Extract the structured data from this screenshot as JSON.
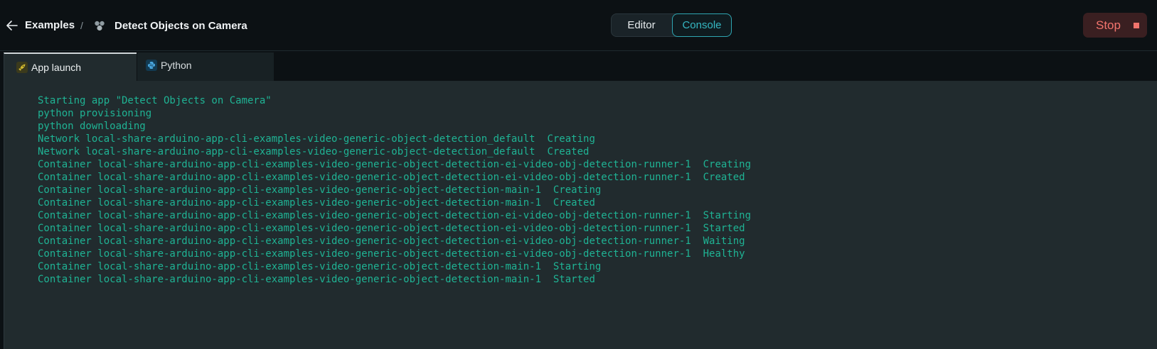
{
  "header": {
    "breadcrumb_root": "Examples",
    "breadcrumb_sep": "/",
    "app_title": "Detect Objects on Camera",
    "view_toggle": {
      "editor_label": "Editor",
      "console_label": "Console",
      "active": "Console"
    },
    "stop_label": "Stop"
  },
  "tabs": [
    {
      "label": "App launch",
      "icon": "rocket-icon",
      "active": true,
      "icon_color": "#c9b22f"
    },
    {
      "label": "Python",
      "icon": "python-icon",
      "active": false,
      "icon_color": "#2b8ec9"
    }
  ],
  "console": {
    "text_color": "#1fb394",
    "lines": [
      "Starting app \"Detect Objects on Camera\"",
      "python provisioning",
      "python downloading",
      "Network local-share-arduino-app-cli-examples-video-generic-object-detection_default  Creating",
      "Network local-share-arduino-app-cli-examples-video-generic-object-detection_default  Created",
      "Container local-share-arduino-app-cli-examples-video-generic-object-detection-ei-video-obj-detection-runner-1  Creating",
      "Container local-share-arduino-app-cli-examples-video-generic-object-detection-ei-video-obj-detection-runner-1  Created",
      "Container local-share-arduino-app-cli-examples-video-generic-object-detection-main-1  Creating",
      "Container local-share-arduino-app-cli-examples-video-generic-object-detection-main-1  Created",
      "Container local-share-arduino-app-cli-examples-video-generic-object-detection-ei-video-obj-detection-runner-1  Starting",
      "Container local-share-arduino-app-cli-examples-video-generic-object-detection-ei-video-obj-detection-runner-1  Started",
      "Container local-share-arduino-app-cli-examples-video-generic-object-detection-ei-video-obj-detection-runner-1  Waiting",
      "Container local-share-arduino-app-cli-examples-video-generic-object-detection-ei-video-obj-detection-runner-1  Healthy",
      "Container local-share-arduino-app-cli-examples-video-generic-object-detection-main-1  Starting",
      "Container local-share-arduino-app-cli-examples-video-generic-object-detection-main-1  Started"
    ]
  },
  "colors": {
    "accent": "#2ea6b2",
    "stop": "#f2746d",
    "console_bg": "#212b2e",
    "header_bg": "#0c1114"
  }
}
